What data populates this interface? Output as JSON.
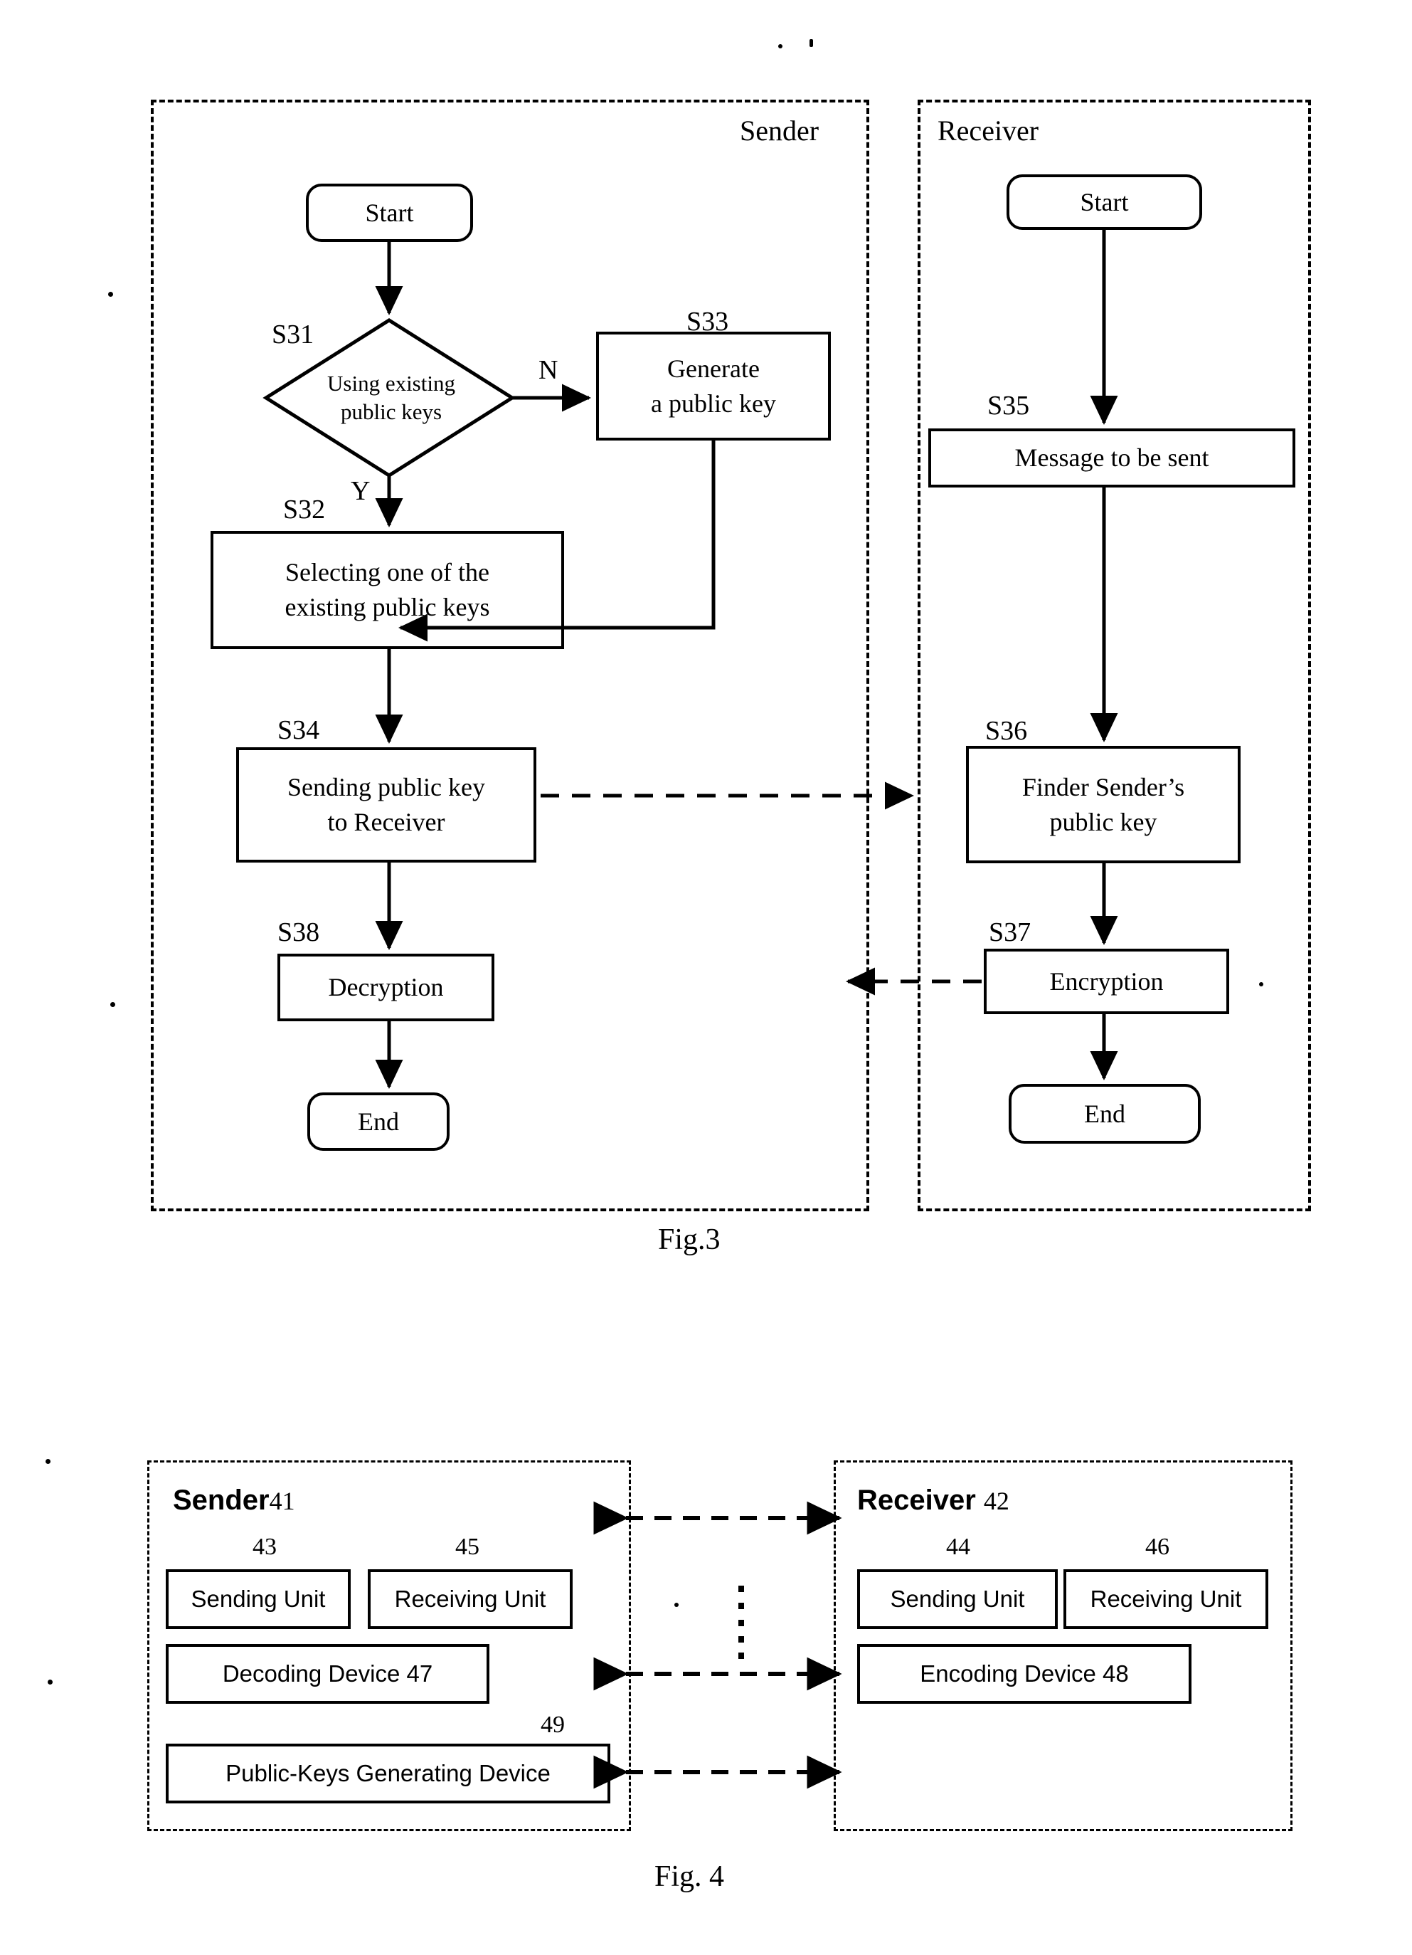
{
  "figures": [
    {
      "id": "fig3",
      "caption": "Fig.3",
      "lanes": [
        {
          "name": "sender",
          "title": "Sender"
        },
        {
          "name": "receiver",
          "title": "Receiver"
        }
      ],
      "nodes": [
        {
          "id": "s_start",
          "lane": "sender",
          "shape": "terminator",
          "text": "Start"
        },
        {
          "id": "s31",
          "lane": "sender",
          "shape": "decision",
          "step": "S31",
          "text": "Using existing public keys",
          "line1": "Using existing",
          "line2": "public keys"
        },
        {
          "id": "s33",
          "lane": "sender",
          "shape": "process",
          "step": "S33",
          "line1": "Generate",
          "line2": "a public key"
        },
        {
          "id": "s32",
          "lane": "sender",
          "shape": "process",
          "step": "S32",
          "line1": "Selecting one of the",
          "line2": "existing public keys"
        },
        {
          "id": "s34",
          "lane": "sender",
          "shape": "process",
          "step": "S34",
          "line1": "Sending public key",
          "line2": "to Receiver"
        },
        {
          "id": "s38",
          "lane": "sender",
          "shape": "process",
          "step": "S38",
          "line1": "Decryption",
          "line2": ""
        },
        {
          "id": "s_end",
          "lane": "sender",
          "shape": "terminator",
          "text": "End"
        },
        {
          "id": "r_start",
          "lane": "receiver",
          "shape": "terminator",
          "text": "Start"
        },
        {
          "id": "s35",
          "lane": "receiver",
          "shape": "process",
          "step": "S35",
          "line1": "Message to be sent",
          "line2": ""
        },
        {
          "id": "s36",
          "lane": "receiver",
          "shape": "process",
          "step": "S36",
          "line1": "Finder Sender’s",
          "line2": "public key"
        },
        {
          "id": "s37",
          "lane": "receiver",
          "shape": "process",
          "step": "S37",
          "line1": "Encryption",
          "line2": ""
        },
        {
          "id": "r_end",
          "lane": "receiver",
          "shape": "terminator",
          "text": "End"
        }
      ],
      "branch_labels": {
        "no": "N",
        "yes": "Y"
      }
    },
    {
      "id": "fig4",
      "caption": "Fig. 4",
      "lanes": [
        {
          "name": "sender",
          "title": "Sender",
          "number": "41",
          "units": [
            {
              "label": "Sending Unit",
              "number": "43"
            },
            {
              "label": "Receiving Unit",
              "number": "45"
            }
          ],
          "devices": [
            {
              "label": "Decoding Device 47",
              "number": ""
            },
            {
              "label": "Public-Keys Generating Device",
              "number": "49"
            }
          ]
        },
        {
          "name": "receiver",
          "title": "Receiver",
          "number": "42",
          "units": [
            {
              "label": "Sending Unit",
              "number": "44"
            },
            {
              "label": "Receiving Unit",
              "number": "46"
            }
          ],
          "devices": [
            {
              "label": "Encoding Device 48",
              "number": ""
            }
          ]
        }
      ]
    }
  ],
  "colors": {
    "ink": "#000000",
    "paper": "#ffffff"
  }
}
